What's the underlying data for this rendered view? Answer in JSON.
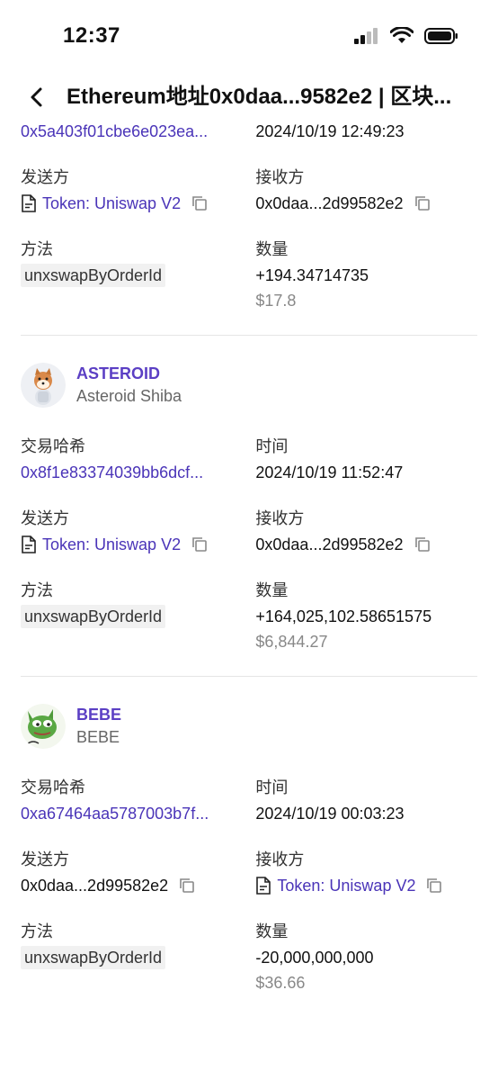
{
  "status": {
    "time": "12:37"
  },
  "nav": {
    "title": "Ethereum地址0x0daa...9582e2 | 区块..."
  },
  "labels": {
    "hash": "交易哈希",
    "time": "时间",
    "from": "发送方",
    "to": "接收方",
    "method": "方法",
    "amount": "数量"
  },
  "transactions": [
    {
      "hash": "0x5a403f01cbe6e023ea...",
      "time": "2024/10/19 12:49:23",
      "from": "Token: Uniswap V2",
      "to": "0x0daa...2d99582e2",
      "method": "unxswapByOrderId",
      "amount": "+194.34714735",
      "usd": "$17.8"
    },
    {
      "token_symbol": "ASTEROID",
      "token_name": "Asteroid Shiba",
      "hash": "0x8f1e83374039bb6dcf...",
      "time": "2024/10/19 11:52:47",
      "from": "Token: Uniswap V2",
      "to": "0x0daa...2d99582e2",
      "method": "unxswapByOrderId",
      "amount": "+164,025,102.58651575",
      "usd": "$6,844.27"
    },
    {
      "token_symbol": "BEBE",
      "token_name": "BEBE",
      "hash": "0xa67464aa5787003b7f...",
      "time": "2024/10/19 00:03:23",
      "from": "0x0daa...2d99582e2",
      "to": "Token: Uniswap V2",
      "method": "unxswapByOrderId",
      "amount": "-20,000,000,000",
      "usd": "$36.66"
    }
  ],
  "colors": {
    "link": "#4a34b8",
    "symbol": "#5b3fc4",
    "muted": "#888888"
  },
  "icons": [
    "back-arrow-icon",
    "signal-icon",
    "wifi-icon",
    "battery-icon",
    "contract-doc-icon",
    "copy-icon"
  ]
}
